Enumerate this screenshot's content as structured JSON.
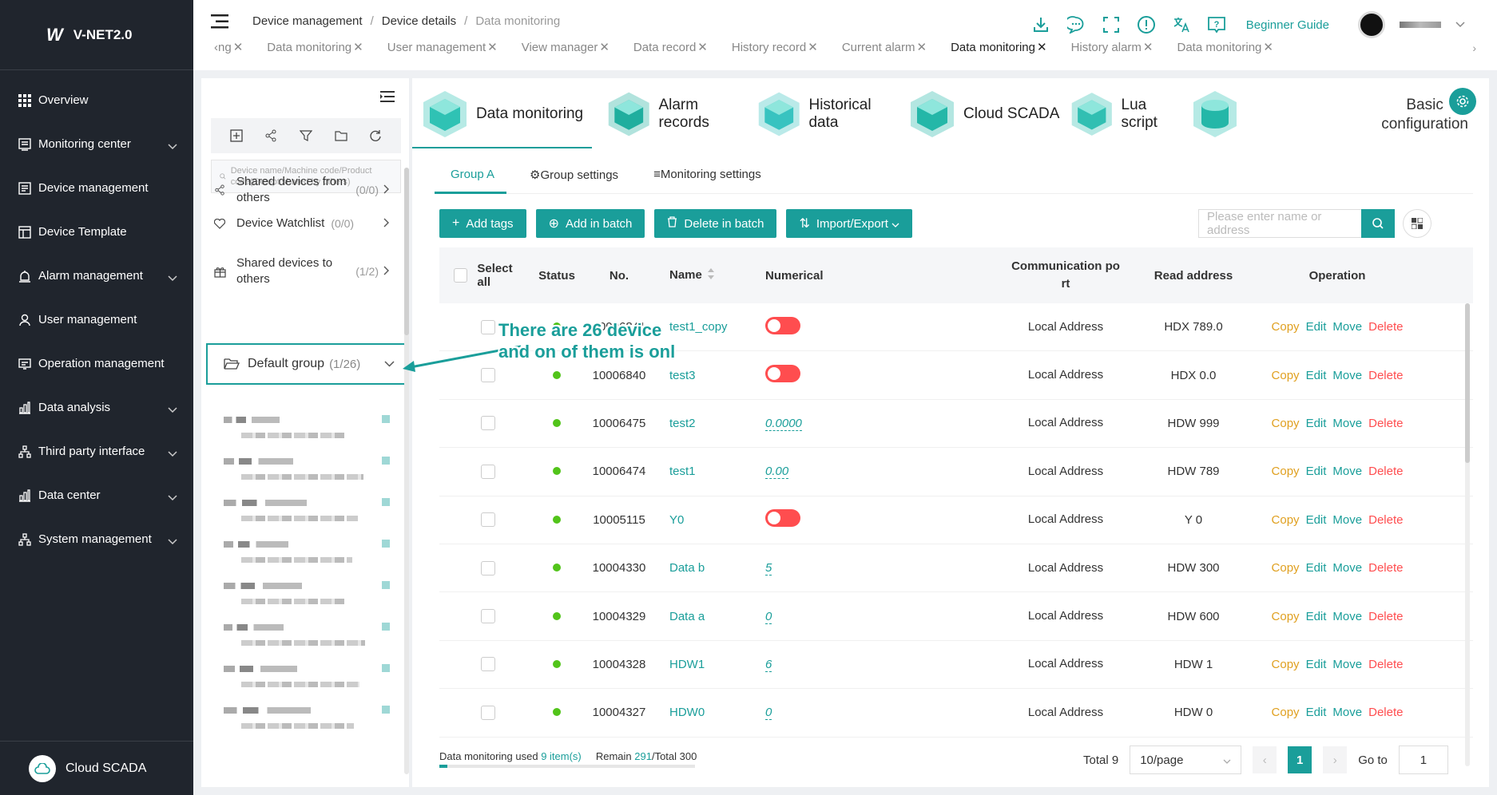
{
  "app": {
    "logo_mark": "W",
    "logo_text": "V-NET2.0"
  },
  "sidebar": {
    "items": [
      {
        "label": "Overview",
        "icon": "grid-icon",
        "expandable": false
      },
      {
        "label": "Monitoring center",
        "icon": "monitor-icon",
        "expandable": true
      },
      {
        "label": "Device management",
        "icon": "device-icon",
        "expandable": false
      },
      {
        "label": "Device Template",
        "icon": "template-icon",
        "expandable": false
      },
      {
        "label": "Alarm management",
        "icon": "alarm-icon",
        "expandable": true
      },
      {
        "label": "User management",
        "icon": "user-icon",
        "expandable": false
      },
      {
        "label": "Operation management",
        "icon": "operation-icon",
        "expandable": false
      },
      {
        "label": "Data analysis",
        "icon": "chart-icon",
        "expandable": true
      },
      {
        "label": "Third party interface",
        "icon": "network-icon",
        "expandable": true
      },
      {
        "label": "Data center",
        "icon": "chart-icon",
        "expandable": true
      },
      {
        "label": "System management",
        "icon": "network-icon",
        "expandable": true
      }
    ],
    "bottom_label": "Cloud SCADA"
  },
  "header": {
    "breadcrumb": [
      "Device management",
      "Device details",
      "Data monitoring"
    ],
    "guide_label": "Beginner Guide"
  },
  "tabs": [
    {
      "label": "‹ng",
      "active": false
    },
    {
      "label": "Data monitoring",
      "active": false
    },
    {
      "label": "User management",
      "active": false
    },
    {
      "label": "View manager",
      "active": false
    },
    {
      "label": "Data record",
      "active": false
    },
    {
      "label": "History record",
      "active": false
    },
    {
      "label": "Current alarm",
      "active": false
    },
    {
      "label": "Data monitoring",
      "active": true
    },
    {
      "label": "History alarm",
      "active": false
    },
    {
      "label": "Data monitoring",
      "active": false
    }
  ],
  "left_panel": {
    "search_placeholder": "Device name/Machine code/Product code(Except shared by others)",
    "shared_from": {
      "label": "Shared devices from others",
      "count": "(0/0)"
    },
    "watchlist": {
      "label": "Device Watchlist",
      "count": "(0/0)"
    },
    "shared_to": {
      "label": "Shared devices to others",
      "count": "(1/2)"
    },
    "default_group": {
      "label": "Default group",
      "count": "(1/26)"
    }
  },
  "function_tabs": [
    {
      "label": "Data monitoring",
      "active": true
    },
    {
      "label": "Alarm records",
      "active": false
    },
    {
      "label": "Historical data",
      "active": false
    },
    {
      "label": "Cloud SCADA",
      "active": false
    },
    {
      "label": "Lua script",
      "active": false
    }
  ],
  "basic_config": {
    "line1": "Basic",
    "line2": "configuration"
  },
  "subtabs": {
    "group": "Group A",
    "group_settings": "Group settings",
    "monitoring_settings": "Monitoring settings"
  },
  "toolbar": {
    "add_tags": "Add tags",
    "add_batch": "Add in batch",
    "delete_batch": "Delete in batch",
    "import_export": "Import/Export",
    "search_placeholder": "Please enter name or address"
  },
  "table": {
    "headers": {
      "select_all": "Select all",
      "status": "Status",
      "no": "No.",
      "name": "Name",
      "numerical": "Numerical",
      "port_line1": "Communication po",
      "port_line2": "rt",
      "read_address": "Read address",
      "operation": "Operation"
    },
    "ops": {
      "copy": "Copy",
      "edit": "Edit",
      "move": "Move",
      "delete": "Delete"
    },
    "rows": [
      {
        "no": "10006841",
        "name": "test1_copy",
        "value": "",
        "toggle": true,
        "port": "Local Address",
        "address": "HDX 789.0"
      },
      {
        "no": "10006840",
        "name": "test3",
        "value": "",
        "toggle": true,
        "port": "Local Address",
        "address": "HDX 0.0"
      },
      {
        "no": "10006475",
        "name": "test2",
        "value": "0.0000",
        "toggle": false,
        "port": "Local Address",
        "address": "HDW 999"
      },
      {
        "no": "10006474",
        "name": "test1",
        "value": "0.00",
        "toggle": false,
        "port": "Local Address",
        "address": "HDW 789"
      },
      {
        "no": "10005115",
        "name": "Y0",
        "value": "",
        "toggle": true,
        "port": "Local Address",
        "address": "Y 0"
      },
      {
        "no": "10004330",
        "name": "Data b",
        "value": "5",
        "toggle": false,
        "port": "Local Address",
        "address": "HDW 300"
      },
      {
        "no": "10004329",
        "name": "Data a",
        "value": "0",
        "toggle": false,
        "port": "Local Address",
        "address": "HDW 600"
      },
      {
        "no": "10004328",
        "name": "HDW1",
        "value": "6",
        "toggle": false,
        "port": "Local Address",
        "address": "HDW 1"
      },
      {
        "no": "10004327",
        "name": "HDW0",
        "value": "0",
        "toggle": false,
        "port": "Local Address",
        "address": "HDW 0"
      }
    ]
  },
  "footer": {
    "used_prefix": "Data monitoring used",
    "used_count": "9 item(s)",
    "remain_prefix": "Remain",
    "remain_count": "291",
    "total": "/Total 300",
    "usage_fraction": 0.03,
    "total_label": "Total 9",
    "page_size": "10/page",
    "current_page": "1",
    "goto_label": "Go to",
    "goto_value": "1"
  },
  "annotation": {
    "line1": "There are 26 device",
    "line2": "and on of them is onl"
  },
  "colors": {
    "accent": "#1a9e9a",
    "sidebar_bg": "#20252d",
    "danger": "#ff4d4f",
    "warning": "#e0a020",
    "online": "#52c41a"
  }
}
